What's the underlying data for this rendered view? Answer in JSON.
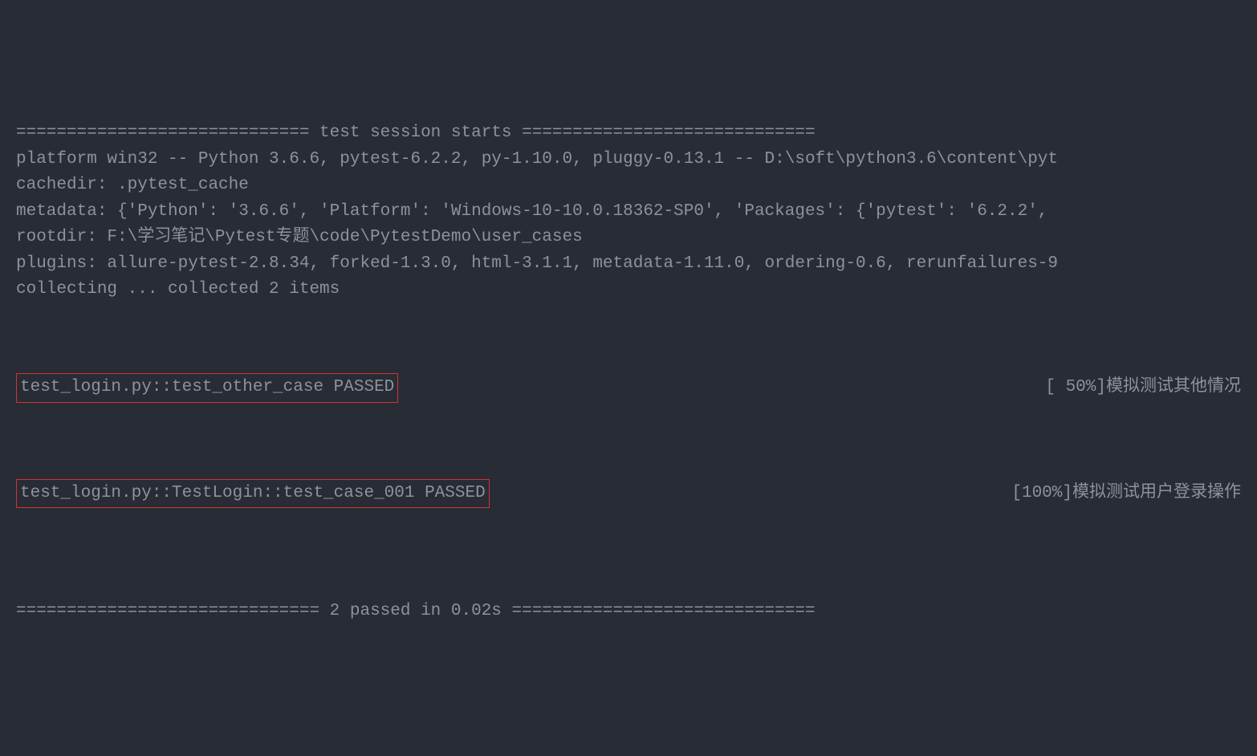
{
  "header": {
    "session_starts": "============================= test session starts =============================",
    "platform": "platform win32 -- Python 3.6.6, pytest-6.2.2, py-1.10.0, pluggy-0.13.1 -- D:\\soft\\python3.6\\content\\pyt",
    "cachedir": "cachedir: .pytest_cache",
    "metadata": "metadata: {'Python': '3.6.6', 'Platform': 'Windows-10-10.0.18362-SP0', 'Packages': {'pytest': '6.2.2',",
    "rootdir": "rootdir: F:\\学习笔记\\Pytest专题\\code\\PytestDemo\\user_cases",
    "plugins": "plugins: allure-pytest-2.8.34, forked-1.3.0, html-3.1.1, metadata-1.11.0, ordering-0.6, rerunfailures-9",
    "collecting": "collecting ... collected 2 items"
  },
  "results": [
    {
      "case": "test_login.py::test_other_case PASSED",
      "progress": "[ 50%]",
      "description": "模拟测试其他情况"
    },
    {
      "case": "test_login.py::TestLogin::test_case_001 PASSED",
      "progress": "[100%]",
      "description": "模拟测试用户登录操作"
    }
  ],
  "footer": {
    "summary": "============================== 2 passed in 0.02s =============================="
  }
}
